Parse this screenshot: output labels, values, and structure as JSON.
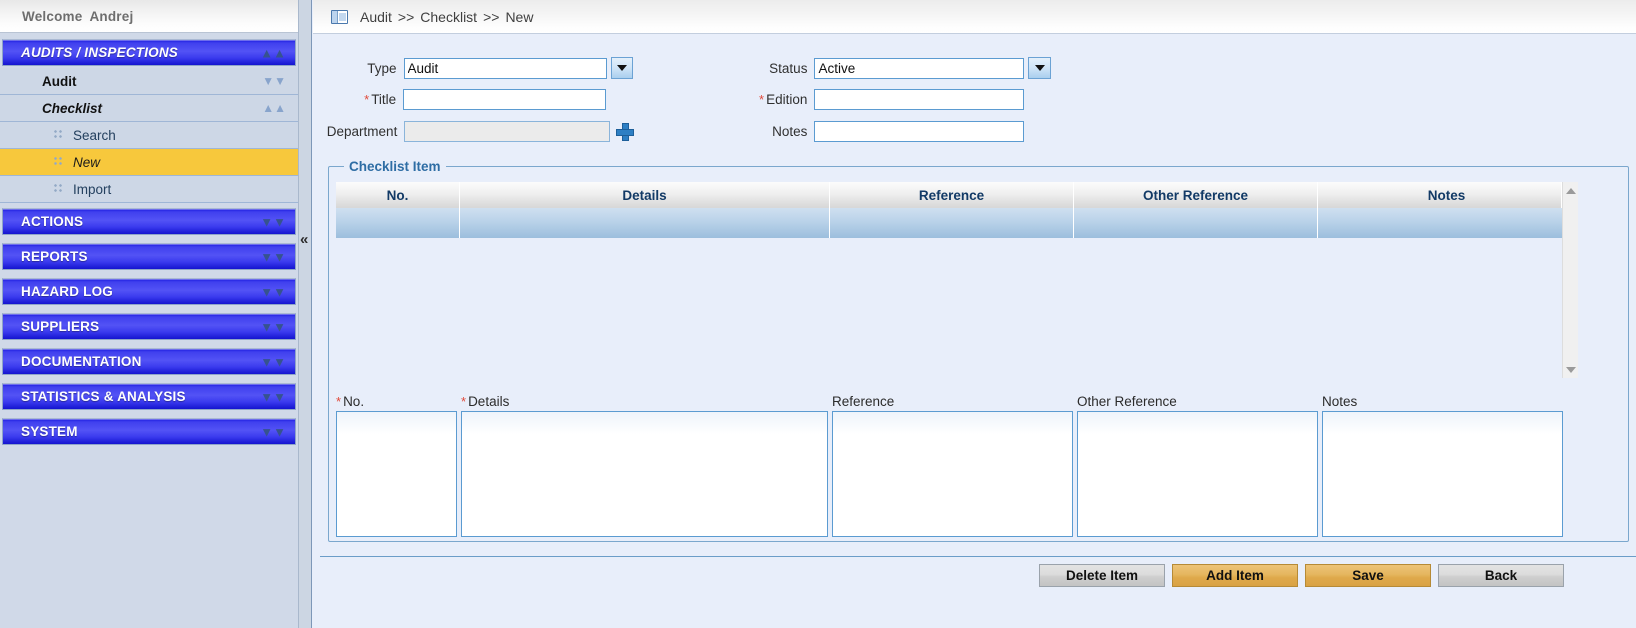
{
  "welcome": {
    "greeting": "Welcome",
    "user": "Andrej"
  },
  "sidebar": {
    "groups": [
      {
        "label": "AUDITS / INSPECTIONS",
        "chevron": "chevron-up-icon",
        "expanded": true,
        "active": true
      },
      {
        "label": "ACTIONS",
        "chevron": "chevron-down-icon",
        "expanded": false,
        "active": false
      },
      {
        "label": "REPORTS",
        "chevron": "chevron-down-icon",
        "expanded": false,
        "active": false
      },
      {
        "label": "HAZARD LOG",
        "chevron": "chevron-down-icon",
        "expanded": false,
        "active": false
      },
      {
        "label": "SUPPLIERS",
        "chevron": "chevron-down-icon",
        "expanded": false,
        "active": false
      },
      {
        "label": "DOCUMENTATION",
        "chevron": "chevron-down-icon",
        "expanded": false,
        "active": false
      },
      {
        "label": "STATISTICS & ANALYSIS",
        "chevron": "chevron-down-icon",
        "expanded": false,
        "active": false
      },
      {
        "label": "SYSTEM",
        "chevron": "chevron-down-icon",
        "expanded": false,
        "active": false
      }
    ],
    "sub_audit": {
      "label": "Audit",
      "chevron": "chevron-down-icon"
    },
    "sub_checklist": {
      "label": "Checklist",
      "chevron": "chevron-up-icon"
    },
    "leaves": [
      {
        "label": "Search",
        "selected": false
      },
      {
        "label": "New",
        "selected": true
      },
      {
        "label": "Import",
        "selected": false
      }
    ],
    "collapse_glyph": "«"
  },
  "breadcrumb": {
    "icon": "window-list-icon",
    "root": "Audit",
    "sep1": ">>",
    "level2": "Checklist",
    "sep2": ">>",
    "level3": "New"
  },
  "form": {
    "type": {
      "label": "Type",
      "value": "Audit",
      "required": false,
      "dropdown": true
    },
    "title": {
      "label": "Title",
      "value": "",
      "required": true
    },
    "department": {
      "label": "Department",
      "value": "",
      "required": false,
      "readonly": true,
      "add_icon": "plus-icon"
    },
    "status": {
      "label": "Status",
      "value": "Active",
      "required": false,
      "dropdown": true
    },
    "edition": {
      "label": "Edition",
      "value": "",
      "required": true
    },
    "notes": {
      "label": "Notes",
      "value": "",
      "required": false
    }
  },
  "checklist_item": {
    "legend": "Checklist Item",
    "columns": [
      "No.",
      "Details",
      "Reference",
      "Other Reference",
      "Notes"
    ],
    "rows": [],
    "scrollbar": {
      "up_icon": "triangle-up-icon",
      "down_icon": "triangle-down-icon"
    }
  },
  "editor": {
    "no": {
      "label": "No.",
      "required": true,
      "value": ""
    },
    "details": {
      "label": "Details",
      "required": true,
      "value": ""
    },
    "reference": {
      "label": "Reference",
      "required": false,
      "value": ""
    },
    "other_reference": {
      "label": "Other Reference",
      "required": false,
      "value": ""
    },
    "notes": {
      "label": "Notes",
      "required": false,
      "value": ""
    }
  },
  "footer": {
    "delete_item": "Delete Item",
    "add_item": "Add Item",
    "save": "Save",
    "back": "Back"
  },
  "colors": {
    "sidebar_group_blue": "#3a3aee",
    "selected_leaf_gold": "#f7c83c",
    "button_gold": "#dfa94b",
    "accent_blue": "#2e6da4",
    "required_red": "#e04a3a",
    "page_bg": "#e8eefa"
  }
}
